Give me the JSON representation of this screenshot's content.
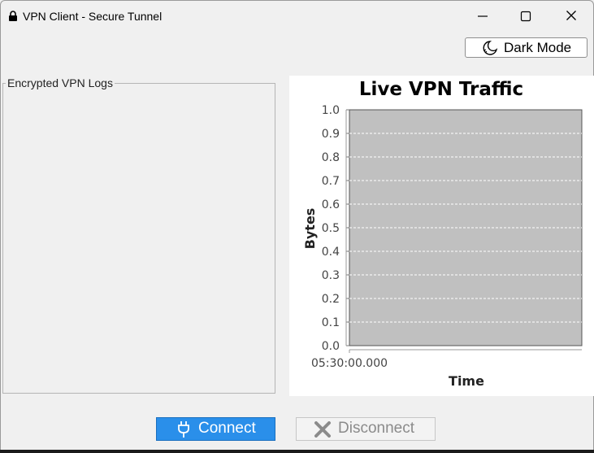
{
  "window": {
    "title": "VPN Client - Secure Tunnel",
    "icon": "lock-icon"
  },
  "toolbar": {
    "dark_mode_label": "Dark Mode",
    "dark_mode_icon": "moon-icon"
  },
  "logs": {
    "title": "Encrypted VPN Logs",
    "entries": []
  },
  "chart_data": {
    "type": "line",
    "title": "Live VPN Traffic",
    "xlabel": "Time",
    "ylabel": "Bytes",
    "x": [],
    "series": [],
    "x_tick_labels": [
      "05:30:00.000"
    ],
    "ylim": [
      0.0,
      1.0
    ],
    "y_ticks": [
      0.0,
      0.1,
      0.2,
      0.3,
      0.4,
      0.5,
      0.6,
      0.7,
      0.8,
      0.9,
      1.0
    ],
    "grid": true,
    "plot_background": "#c0c0c0",
    "grid_color": "#ffffff"
  },
  "actions": {
    "connect_label": "Connect",
    "connect_icon": "plug-icon",
    "disconnect_label": "Disconnect",
    "disconnect_icon": "x-icon",
    "accent_color": "#2a8fea",
    "disabled_text_color": "#8b8b8b"
  }
}
